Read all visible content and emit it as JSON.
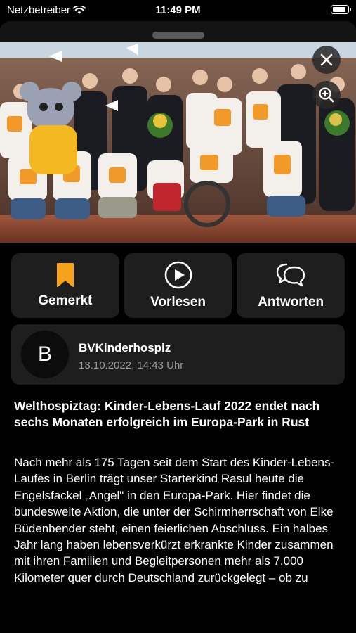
{
  "status_bar": {
    "carrier": "Netzbetreiber",
    "time": "11:49 PM"
  },
  "actions": [
    {
      "label": "Gemerkt",
      "icon": "bookmark-icon"
    },
    {
      "label": "Vorlesen",
      "icon": "play-circle-icon"
    },
    {
      "label": "Antworten",
      "icon": "reply-bubble-icon"
    }
  ],
  "author": {
    "initial": "B",
    "name": "BVKinderhospiz",
    "date": "13.10.2022, 14:43 Uhr"
  },
  "article": {
    "headline": "Welthospiztag: Kinder-Lebens-Lauf 2022 endet nach sechs Monaten erfolgreich im Europa-Park in Rust",
    "body": "Nach mehr als 175 Tagen seit dem Start des Kinder-Lebens-Laufes in Berlin trägt unser Starterkind Rasul heute die Engelsfackel „Angel\" in den Europa-Park. Hier findet die bundesweite Aktion, die unter der Schirmherrschaft von Elke Büdenbender steht, einen feierlichen Abschluss. Ein halbes Jahr lang haben lebensverkürzt erkrankte Kinder zusammen mit ihren Familien und Begleitpersonen mehr als 7.000 Kilometer quer durch Deutschland zurückgelegt – ob zu"
  },
  "colors": {
    "accent": "#f7a21b",
    "card": "#1e1e1e",
    "background": "#000000",
    "secondary_text": "#9a9a9a"
  }
}
